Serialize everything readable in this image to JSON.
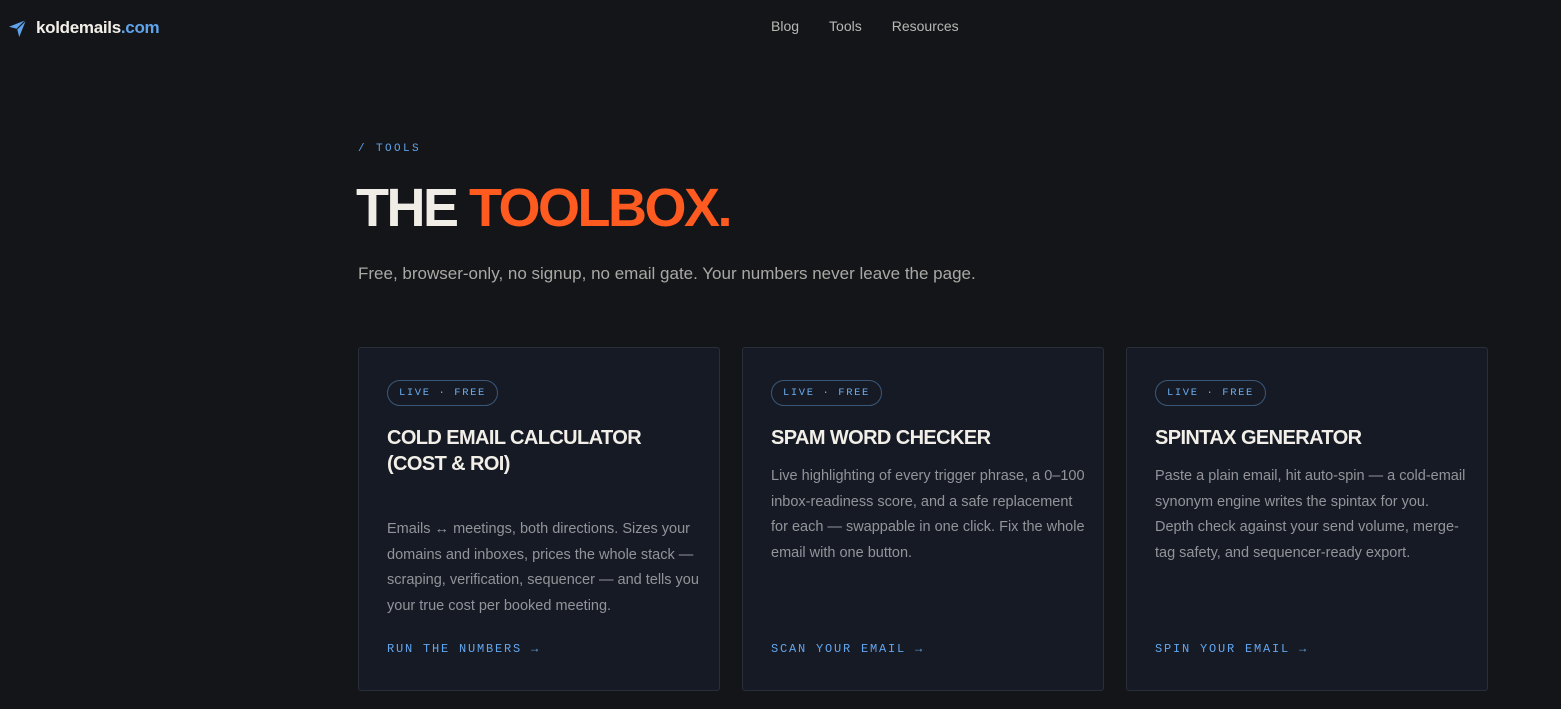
{
  "brand": {
    "name": "koldemails",
    "tld": ".com",
    "icon": "paper-plane-icon",
    "accent_color": "#5fa3ea"
  },
  "nav": {
    "items": [
      {
        "label": "Blog"
      },
      {
        "label": "Tools"
      },
      {
        "label": "Resources"
      }
    ]
  },
  "hero": {
    "eyebrow": "/ TOOLS",
    "title_part1": "THE",
    "title_part2": "TOOLBOX.",
    "title_accent_color": "#ff5a1f",
    "subtitle": "Free, browser-only, no signup, no email gate. Your numbers never leave the page."
  },
  "cards": [
    {
      "badge": "LIVE · FREE",
      "title": "COLD EMAIL CALCULATOR (COST & ROI)",
      "description": "Emails ↔ meetings, both directions. Sizes your domains and inboxes, prices the whole stack — scraping, verification, sequencer — and tells you your true cost per booked meeting.",
      "cta": "RUN THE NUMBERS →"
    },
    {
      "badge": "LIVE · FREE",
      "title": "SPAM WORD CHECKER",
      "description": "Live highlighting of every trigger phrase, a 0–100 inbox-readiness score, and a safe replacement for each — swappable in one click. Fix the whole email with one button.",
      "cta": "SCAN YOUR EMAIL →"
    },
    {
      "badge": "LIVE · FREE",
      "title": "SPINTAX GENERATOR",
      "description": "Paste a plain email, hit auto-spin — a cold-email synonym engine writes the spintax for you. Depth check against your send volume, merge-tag safety, and sequencer-ready export.",
      "cta": "SPIN YOUR EMAIL →"
    }
  ]
}
